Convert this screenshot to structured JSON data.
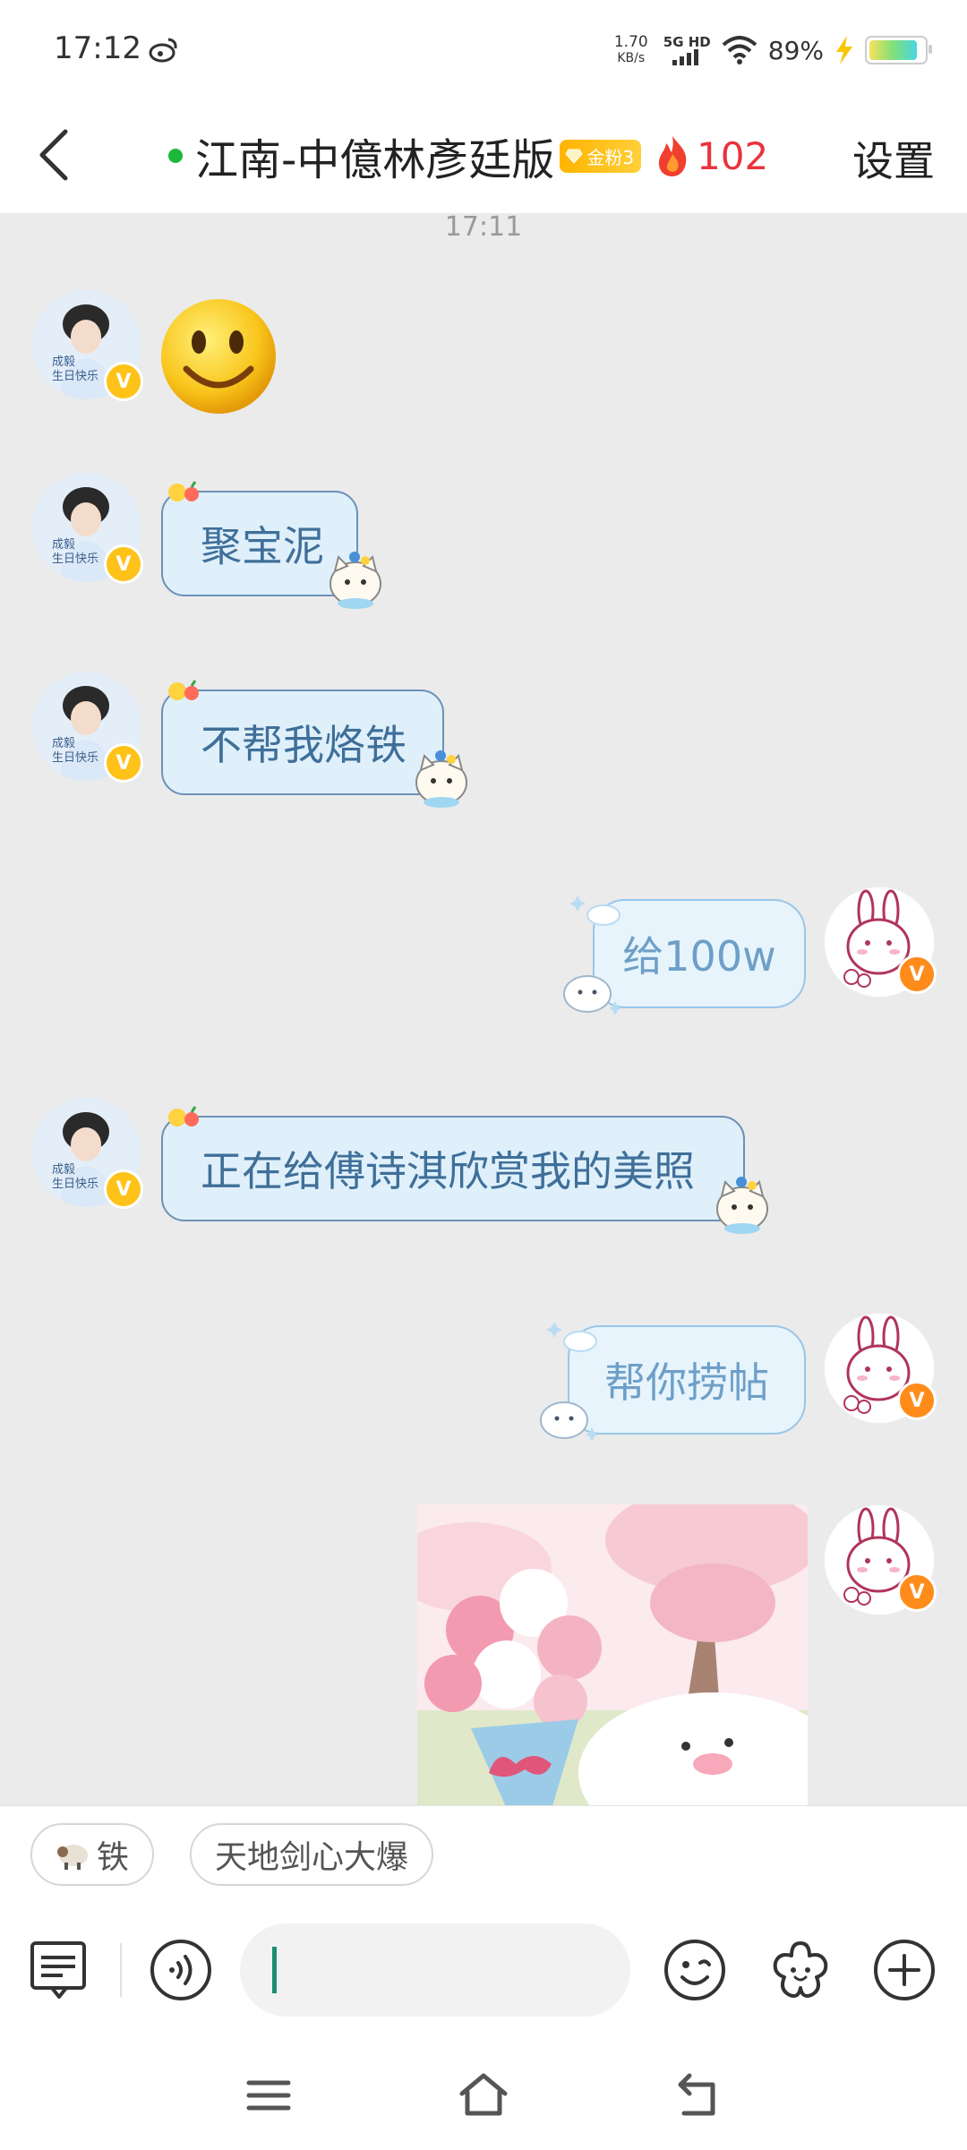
{
  "status_bar": {
    "time": "17:12",
    "net_speed_value": "1.70",
    "net_speed_unit": "KB/s",
    "signal_label": "5G HD",
    "battery_percent": "89%",
    "battery_level": 0.89
  },
  "header": {
    "title": "江南-中億林彥廷版",
    "fan_badge": "金粉3",
    "fire_count": "102",
    "settings_label": "设置"
  },
  "messages": {
    "timestamp": "17:11",
    "bubble_1": "聚宝泥",
    "bubble_2": "不帮我烙铁",
    "bubble_3": "给100w",
    "bubble_4": "正在给傅诗淇欣赏我的美照",
    "bubble_5": "帮你捞帖"
  },
  "avatar_labels": {
    "line1": "成毅",
    "line2": "生日快乐",
    "badge": "V"
  },
  "quick_replies": [
    "铁",
    "天地剑心大爆"
  ],
  "input": {
    "placeholder": ""
  },
  "colors": {
    "accent_green": "#1db83a",
    "fire_red": "#e8333d",
    "badge_gold": "#ffb400",
    "bubble_left_border": "#6c91b6",
    "bubble_right_border": "#9ac6e8"
  },
  "icons": {
    "toolbar": [
      "message-list-icon",
      "voice-icon",
      "emoji-icon",
      "flower-sticker-icon",
      "plus-icon"
    ],
    "nav": [
      "menu-icon",
      "home-icon",
      "back-nav-icon"
    ]
  }
}
